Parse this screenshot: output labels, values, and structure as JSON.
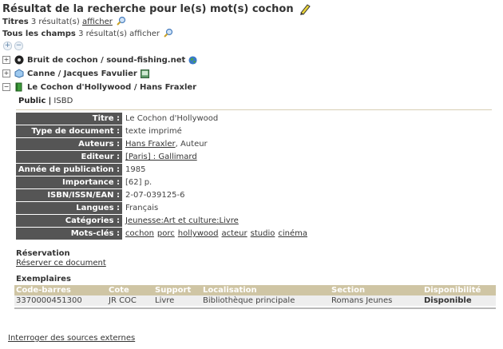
{
  "heading": {
    "title": "Résultat de la recherche pour le(s) mot(s) cochon"
  },
  "summary": [
    {
      "label": "Titres",
      "count": "3 résultat(s)",
      "link": "afficher"
    },
    {
      "label": "Tous les champs",
      "count": "3 résultat(s) afficher",
      "link": ""
    }
  ],
  "expand_controls": {
    "expand": "+",
    "collapse": "−"
  },
  "results": [
    {
      "toggle": "+",
      "label": "Bruit de cochon / sound-fishing.net",
      "type_icon": "disc-icon",
      "suffix_icon": "globe-icon"
    },
    {
      "toggle": "+",
      "label": "Canne / Jacques Favulier",
      "type_icon": "object-icon",
      "suffix_icon": "screen-icon"
    },
    {
      "toggle": "−",
      "label": "Le Cochon d'Hollywood / Hans Fraxler",
      "type_icon": "book-icon"
    }
  ],
  "record_tabs": {
    "public": "Public",
    "separator": "|",
    "isbd": "ISBD"
  },
  "record": {
    "titre_label": "Titre :",
    "titre": "Le Cochon d'Hollywood",
    "type_label": "Type de document :",
    "type": "texte imprimé",
    "auteurs_label": "Auteurs :",
    "auteurs_link": "Hans Fraxler",
    "auteurs_role": ", Auteur",
    "editeur_label": "Editeur :",
    "editeur": "[Paris] : Gallimard",
    "annee_label": "Année de publication :",
    "annee": "1985",
    "importance_label": "Importance :",
    "importance": "[62] p.",
    "isbn_label": "ISBN/ISSN/EAN :",
    "isbn": "2-07-039125-6",
    "langues_label": "Langues :",
    "langues": "Français",
    "categories_label": "Catégories :",
    "categories": "Jeunesse:Art et culture:Livre",
    "motscles_label": "Mots-clés :",
    "motscles": [
      "cochon",
      "porc",
      "hollywood",
      "acteur",
      "studio",
      "cinéma"
    ]
  },
  "reservation": {
    "heading": "Réservation",
    "link": "Réserver ce document"
  },
  "exemplaires": {
    "heading": "Exemplaires",
    "columns": [
      "Code-barres",
      "Cote",
      "Support",
      "Localisation",
      "Section",
      "Disponibilité"
    ],
    "rows": [
      [
        "3370000451300",
        "JR COC",
        "Livre",
        "Bibliothèque principale",
        "Romans Jeunes",
        "Disponible"
      ]
    ]
  },
  "external_link": "Interroger des sources externes",
  "colors": {
    "label_bg": "#555555",
    "table_header": "#cfc5a4",
    "row_bg": "#eeeeee"
  }
}
